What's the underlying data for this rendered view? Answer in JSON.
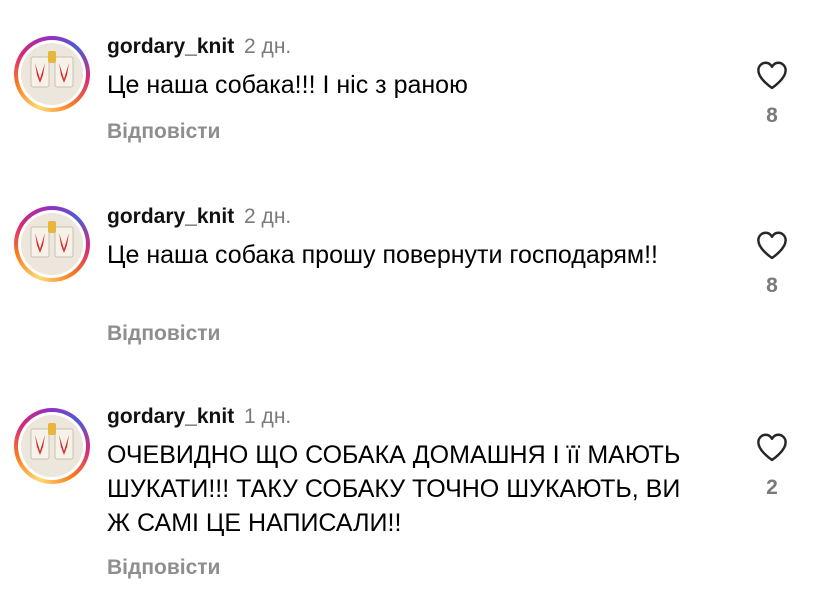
{
  "comments": [
    {
      "username": "gordary_knit",
      "time": "2 дн.",
      "text": "Це наша собака!!! І ніс з раною",
      "reply_label": "Відповісти",
      "likes": "8"
    },
    {
      "username": "gordary_knit",
      "time": "2 дн.",
      "text": "Це наша собака прошу повернути господарям!!",
      "reply_label": "Відповісти",
      "likes": "8"
    },
    {
      "username": "gordary_knit",
      "time": "1 дн.",
      "text": "ОЧЕВИДНО ЩО СОБАКА ДОМАШНЯ І її МАЮТЬ ШУКАТИ!!! ТАКУ СОБАКУ ТОЧНО ШУКАЮТЬ, ВИ Ж САМІ ЦЕ НАПИСАЛИ!!",
      "reply_label": "Відповісти",
      "likes": "2"
    }
  ],
  "icons": {
    "like": "heart-outline-icon",
    "avatar": "knitted-trident-avatar"
  },
  "colors": {
    "secondary_text": "#8e8e8e",
    "time": "#7a7a7a",
    "heart": "#262626"
  }
}
